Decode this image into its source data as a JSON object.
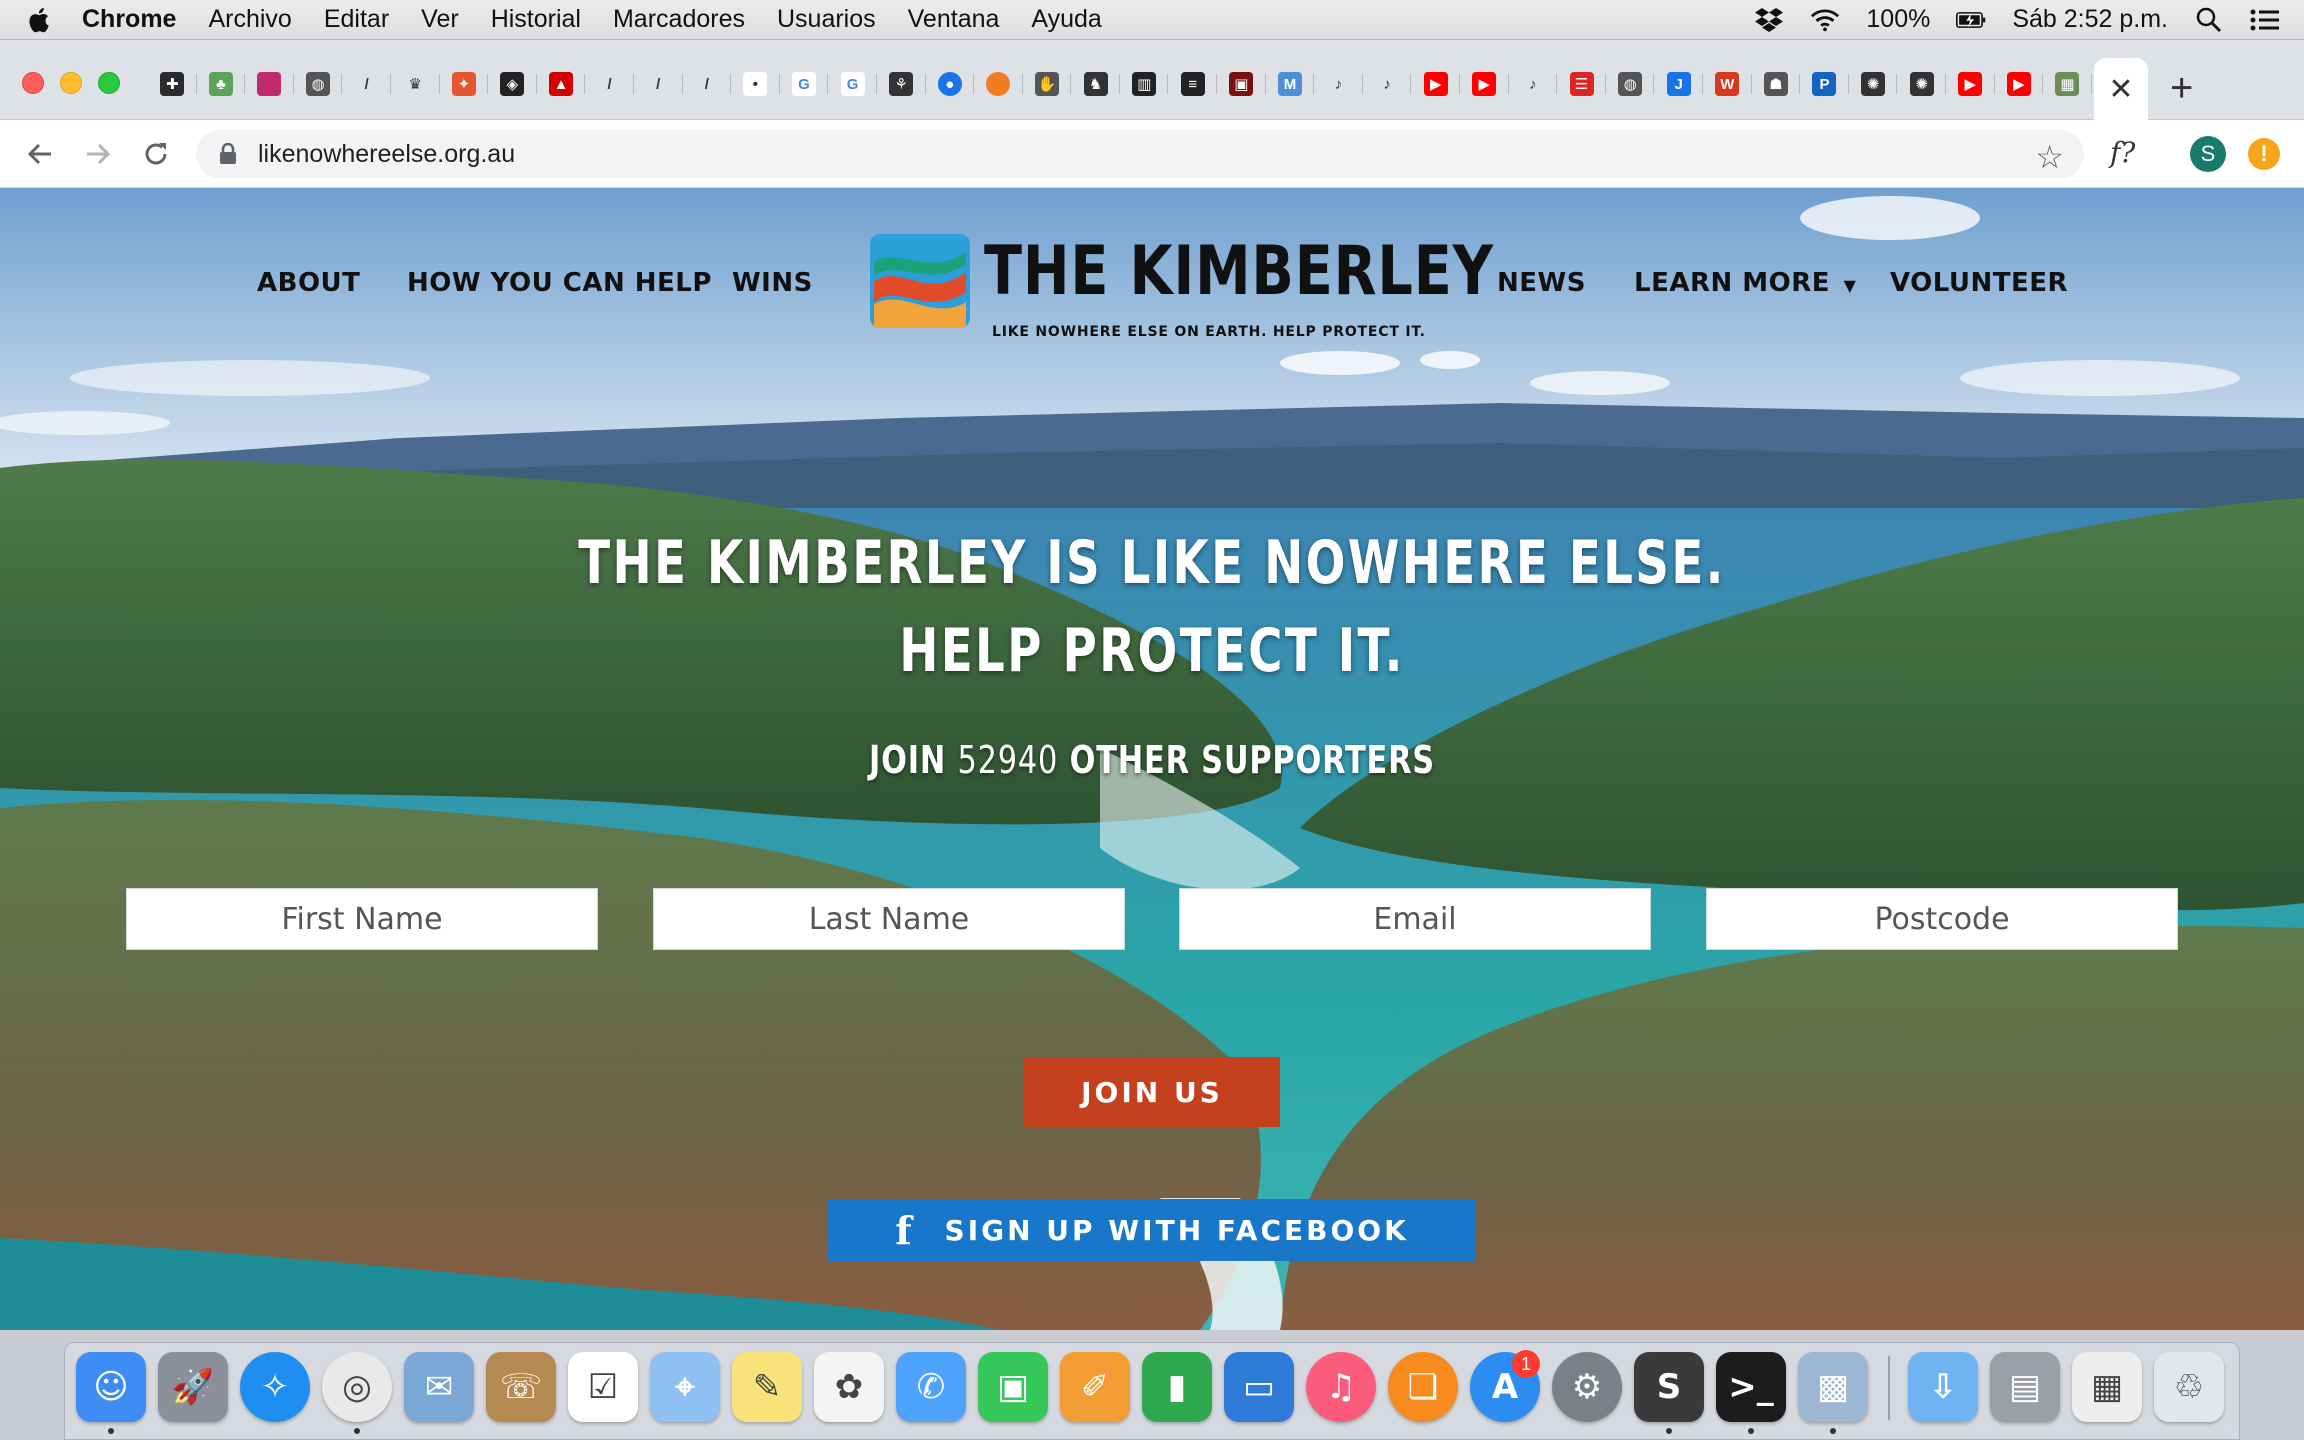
{
  "menubar": {
    "app": "Chrome",
    "items": [
      "Archivo",
      "Editar",
      "Ver",
      "Historial",
      "Marcadores",
      "Usuarios",
      "Ventana",
      "Ayuda"
    ],
    "battery": "100%",
    "clock": "Sáb 2:52 p.m."
  },
  "tabs": {
    "pinned": [
      {
        "icon": "puzzle-favicon",
        "color": "#2b2b2b",
        "glyph": "✚"
      },
      {
        "icon": "tree-favicon",
        "color": "#5aa55a",
        "glyph": "♣"
      },
      {
        "icon": "shield-favicon",
        "color": "#c02b6e",
        "glyph": ""
      },
      {
        "icon": "globe-favicon",
        "color": "#555555",
        "glyph": "◍"
      },
      {
        "icon": "pen-favicon",
        "color": "#dee1e6",
        "glyph": "/"
      },
      {
        "icon": "crest-favicon",
        "color": "#dee1e6",
        "glyph": "♛"
      },
      {
        "icon": "fox-favicon",
        "color": "#e4572e",
        "glyph": "✦"
      },
      {
        "icon": "codepen-favicon",
        "color": "#222222",
        "glyph": "◈"
      },
      {
        "icon": "autodesk-favicon",
        "color": "#d40000",
        "glyph": "▲"
      },
      {
        "icon": "pen-favicon",
        "color": "#dee1e6",
        "glyph": "/"
      },
      {
        "icon": "pen-favicon",
        "color": "#dee1e6",
        "glyph": "/"
      },
      {
        "icon": "pen-favicon",
        "color": "#dee1e6",
        "glyph": "/"
      },
      {
        "icon": "dot-favicon",
        "color": "#ffffff",
        "glyph": "•"
      },
      {
        "icon": "google-favicon",
        "color": "#ffffff",
        "glyph": "G"
      },
      {
        "icon": "google-favicon",
        "color": "#ffffff",
        "glyph": "G"
      },
      {
        "icon": "palm-favicon",
        "color": "#333333",
        "glyph": "⚘"
      },
      {
        "icon": "drop-favicon",
        "color": "#1a73e8",
        "glyph": "●"
      },
      {
        "icon": "orange-circle-favicon",
        "color": "#f07c22",
        "glyph": ""
      },
      {
        "icon": "hand-favicon",
        "color": "#555555",
        "glyph": "✋"
      },
      {
        "icon": "figure-favicon",
        "color": "#333333",
        "glyph": "♞"
      },
      {
        "icon": "barcode-favicon",
        "color": "#222222",
        "glyph": "▥"
      },
      {
        "icon": "lines-favicon",
        "color": "#222222",
        "glyph": "≡"
      },
      {
        "icon": "poster-favicon",
        "color": "#7a1010",
        "glyph": "▣"
      },
      {
        "icon": "mdb-favicon",
        "color": "#4f8fd6",
        "glyph": "M"
      },
      {
        "icon": "music-note-favicon",
        "color": "#dee1e6",
        "glyph": "♪"
      },
      {
        "icon": "music-note-favicon",
        "color": "#dee1e6",
        "glyph": "♪"
      },
      {
        "icon": "youtube-favicon",
        "color": "#ff0000",
        "glyph": "▶"
      },
      {
        "icon": "youtube-favicon",
        "color": "#ff0000",
        "glyph": "▶"
      },
      {
        "icon": "music-note-favicon",
        "color": "#dee1e6",
        "glyph": "♪"
      },
      {
        "icon": "stripes-favicon",
        "color": "#e02424",
        "glyph": "☰"
      },
      {
        "icon": "globe-favicon",
        "color": "#555555",
        "glyph": "◍"
      },
      {
        "icon": "blue-j-favicon",
        "color": "#1a73e8",
        "glyph": "J"
      },
      {
        "icon": "w-favicon",
        "color": "#d9381e",
        "glyph": "W"
      },
      {
        "icon": "ghost-favicon",
        "color": "#555555",
        "glyph": "☗"
      },
      {
        "icon": "ptc-favicon",
        "color": "#1565c0",
        "glyph": "P"
      },
      {
        "icon": "openai-favicon",
        "color": "#333333",
        "glyph": "✺"
      },
      {
        "icon": "openai-favicon",
        "color": "#333333",
        "glyph": "✺"
      },
      {
        "icon": "youtube-favicon",
        "color": "#ff0000",
        "glyph": "▶"
      },
      {
        "icon": "youtube-favicon",
        "color": "#ff0000",
        "glyph": "▶"
      },
      {
        "icon": "photo-favicon",
        "color": "#6b8e5a",
        "glyph": "▦"
      }
    ],
    "active_close": "✕",
    "new_tab": "+"
  },
  "address": {
    "url": "likenowhereelse.org.au",
    "extension_label": "f?",
    "profile_initial": "S",
    "alert_glyph": "!"
  },
  "site": {
    "nav_left": [
      "ABOUT",
      "HOW YOU CAN HELP",
      "WINS"
    ],
    "nav_right": [
      "NEWS",
      "LEARN MORE",
      "VOLUNTEER"
    ],
    "logo_title": "THE KIMBERLEY",
    "logo_tagline": "LIKE NOWHERE ELSE ON EARTH. HELP PROTECT IT.",
    "headline_1": "THE KIMBERLEY IS LIKE NOWHERE ELSE.",
    "headline_2": "HELP PROTECT IT.",
    "supporters_prefix": "JOIN",
    "supporters_count": "52940",
    "supporters_suffix": "OTHER SUPPORTERS",
    "form": {
      "first_name_placeholder": "First Name",
      "last_name_placeholder": "Last Name",
      "email_placeholder": "Email",
      "postcode_placeholder": "Postcode"
    },
    "join_label": "JOIN US",
    "facebook_label": "SIGN UP WITH FACEBOOK",
    "facebook_glyph": "f"
  },
  "dock": {
    "apps": [
      {
        "name": "finder-icon",
        "color": "#3d8df5",
        "glyph": "☺"
      },
      {
        "name": "launchpad-icon",
        "color": "#8a8f99",
        "glyph": "🚀"
      },
      {
        "name": "safari-icon",
        "color": "#1f8ef1",
        "glyph": "✧"
      },
      {
        "name": "chrome-icon",
        "color": "#e9e9e9",
        "glyph": "◎"
      },
      {
        "name": "mail-icon",
        "color": "#7aa7d6",
        "glyph": "✉"
      },
      {
        "name": "contacts-icon",
        "color": "#b58a52",
        "glyph": "☏"
      },
      {
        "name": "reminders-icon",
        "color": "#ffffff",
        "glyph": "☑"
      },
      {
        "name": "maps-icon",
        "color": "#8fc0f2",
        "glyph": "⌖"
      },
      {
        "name": "notes-icon",
        "color": "#f9e27a",
        "glyph": "✎"
      },
      {
        "name": "photos-icon",
        "color": "#f4f4f4",
        "glyph": "✿"
      },
      {
        "name": "messages-icon",
        "color": "#4ea3ff",
        "glyph": "✆"
      },
      {
        "name": "facetime-icon",
        "color": "#35c759",
        "glyph": "▣"
      },
      {
        "name": "pages-icon",
        "color": "#f39c33",
        "glyph": "✐"
      },
      {
        "name": "numbers-icon",
        "color": "#2ea84f",
        "glyph": "▮"
      },
      {
        "name": "keynote-icon",
        "color": "#2f7bd8",
        "glyph": "▭"
      },
      {
        "name": "itunes-icon",
        "color": "#fb5c7c",
        "glyph": "♫"
      },
      {
        "name": "books-icon",
        "color": "#f78a1d",
        "glyph": "❏"
      },
      {
        "name": "app-store-icon",
        "color": "#2d8cf0",
        "glyph": "A"
      },
      {
        "name": "system-preferences-icon",
        "color": "#7b7f86",
        "glyph": "⚙"
      },
      {
        "name": "sublime-text-icon",
        "color": "#3a3a3a",
        "glyph": "S"
      },
      {
        "name": "terminal-icon",
        "color": "#1c1c1c",
        "glyph": ">_"
      },
      {
        "name": "preview-icon",
        "color": "#9cb7d3",
        "glyph": "▩"
      },
      {
        "name": "downloads-folder-icon",
        "color": "#6fb3f2",
        "glyph": "⇩"
      },
      {
        "name": "documents-stack-icon",
        "color": "#9b9ea4",
        "glyph": "▤"
      },
      {
        "name": "screenshot-stack-icon",
        "color": "#eeeeee",
        "glyph": "▦"
      },
      {
        "name": "trash-icon",
        "color": "#e4e7ea",
        "glyph": "♲"
      }
    ],
    "app_store_badge": "1"
  },
  "colors": {
    "join_button": "#c5401d",
    "facebook_button": "#1877c9",
    "water": "#2aa6a7"
  }
}
